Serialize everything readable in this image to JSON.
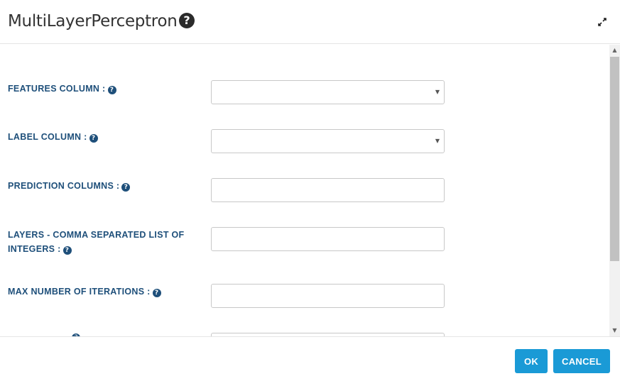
{
  "dialog": {
    "title": "MultiLayerPerceptron",
    "help_glyph": "?",
    "expand_icon": "expand-arrows-icon"
  },
  "form": {
    "fields": [
      {
        "label": "FEATURES COLUMN :",
        "type": "select",
        "value": ""
      },
      {
        "label": "LABEL COLUMN :",
        "type": "select",
        "value": ""
      },
      {
        "label": "PREDICTION COLUMNS :",
        "type": "text",
        "value": ""
      },
      {
        "label_line1": "LAYERS - COMMA SEPARATED LIST OF",
        "label_line2": "INTEGERS :",
        "type": "text",
        "value": ""
      },
      {
        "label": "MAX NUMBER OF ITERATIONS :",
        "type": "text",
        "value": ""
      },
      {
        "type": "text",
        "value": ""
      }
    ],
    "help_glyph": "?",
    "caret_glyph": "▼"
  },
  "footer": {
    "ok_label": "OK",
    "cancel_label": "CANCEL"
  },
  "colors": {
    "label": "#1e4f7a",
    "button": "#1a9ad6"
  }
}
